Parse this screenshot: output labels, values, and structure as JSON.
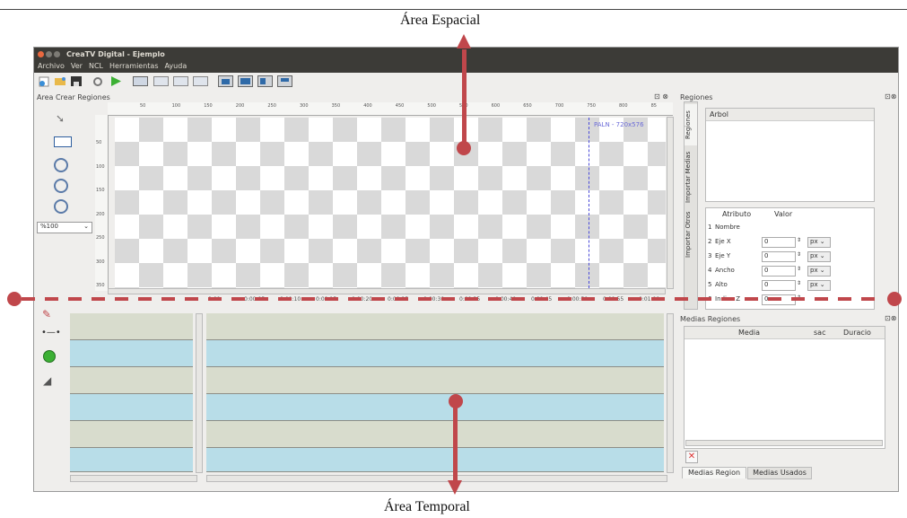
{
  "annotations": {
    "top": "Área Espacial",
    "bottom": "Área Temporal"
  },
  "window": {
    "title": "CreaTV Digital - Ejemplo"
  },
  "menu": [
    "Archivo",
    "Ver",
    "NCL",
    "Herramientas",
    "Ayuda"
  ],
  "toolbar": {
    "icons": [
      "new-icon",
      "open-icon",
      "save-icon",
      "settings-icon",
      "play-icon",
      "palm-icon",
      "paln-icon",
      "ntsc-icon",
      "hdtv-icon",
      "view1-icon",
      "view2-icon",
      "view3-icon",
      "view4-icon"
    ]
  },
  "crear": {
    "title": "Area Crear Regiones",
    "zoom": "%100",
    "canvas_label": "PALN - 720x576",
    "ruler_x": [
      "50",
      "100",
      "150",
      "200",
      "250",
      "300",
      "350",
      "400",
      "450",
      "500",
      "550",
      "600",
      "650",
      "700",
      "750",
      "800",
      "85"
    ],
    "ruler_y": [
      "50",
      "100",
      "150",
      "200",
      "250",
      "300",
      "350"
    ]
  },
  "regiones": {
    "title": "Regiones",
    "tabs": [
      "Regiones",
      "Importar Medias",
      "Importar Otros"
    ],
    "tree_header": "Arbol",
    "attr_header": [
      "Atributo",
      "Valor"
    ],
    "rows": [
      {
        "n": "1",
        "name": "Nombre",
        "value": "",
        "unit": ""
      },
      {
        "n": "2",
        "name": "Eje X",
        "value": "0",
        "unit": "px"
      },
      {
        "n": "3",
        "name": "Eje Y",
        "value": "0",
        "unit": "px"
      },
      {
        "n": "4",
        "name": "Ancho",
        "value": "0",
        "unit": "px"
      },
      {
        "n": "5",
        "name": "Alto",
        "value": "0",
        "unit": "px"
      },
      {
        "n": "6",
        "name": "Indice Z",
        "value": "0",
        "unit": ""
      }
    ]
  },
  "medias": {
    "title": "Medias Regiones",
    "cols": [
      "Media",
      "sac",
      "Duracio"
    ],
    "tabs": [
      "Medias Region",
      "Medias Usados"
    ]
  },
  "timeline": {
    "ticks": [
      "0:00",
      "0:00:05",
      "0:00:10",
      "0:00:15",
      "0:00:20",
      "0:00:25",
      "0:00:30",
      "0:00:35",
      "0:00:40",
      "0:00:45",
      "0:00:50",
      "0:00:55",
      "0:01:00"
    ]
  },
  "colors": {
    "arrow": "#c0474b",
    "track_green": "#d8dccd",
    "track_blue": "#b8dde8",
    "titlebar": "#3c3b37"
  }
}
